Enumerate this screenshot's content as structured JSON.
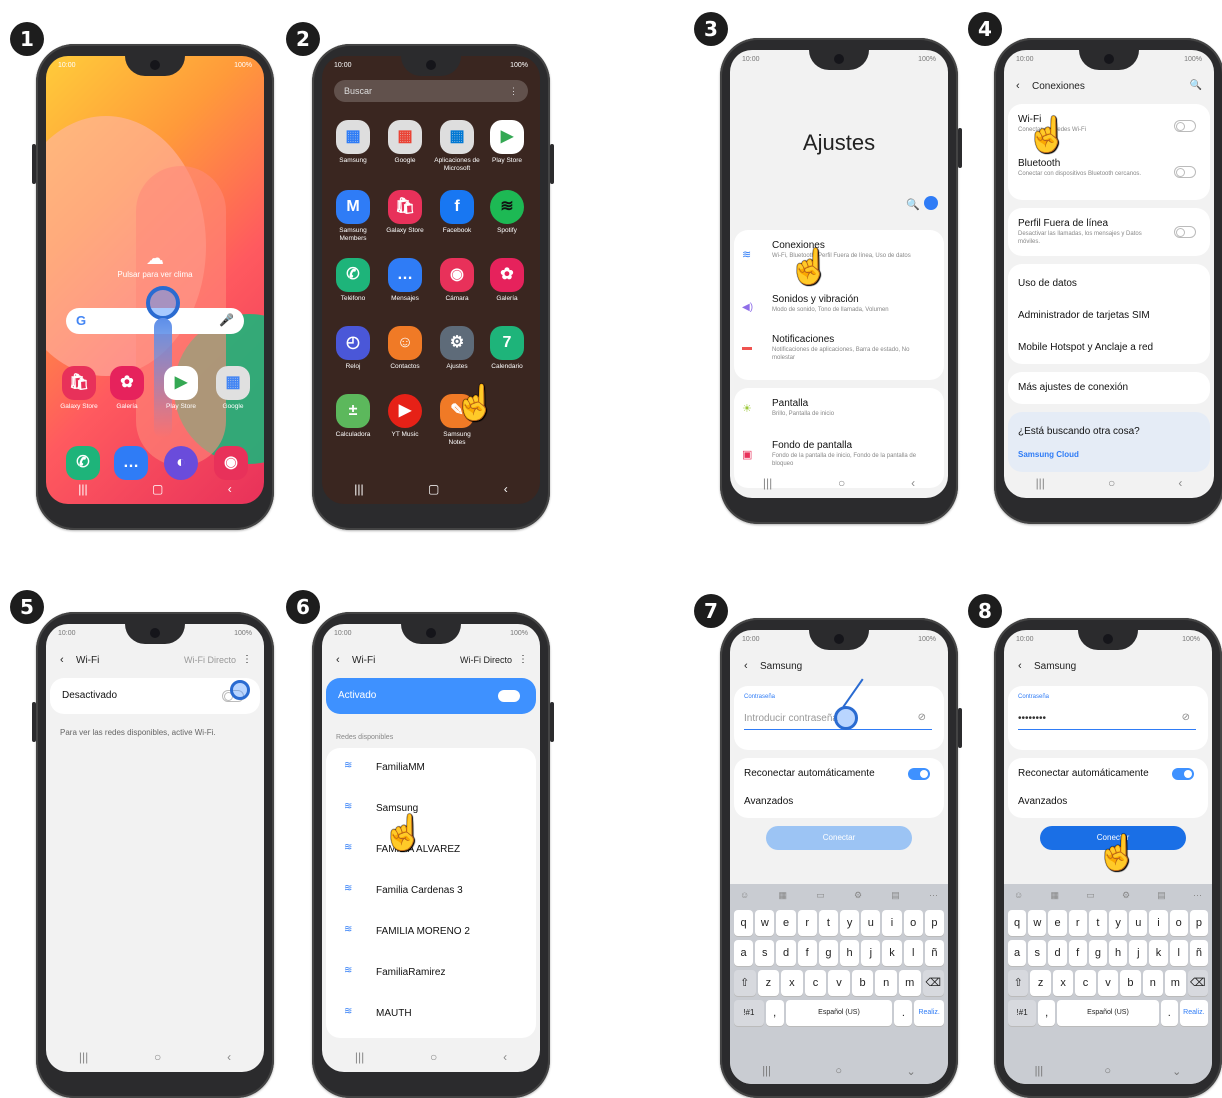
{
  "steps": [
    "1",
    "2",
    "3",
    "4",
    "5",
    "6",
    "7",
    "8"
  ],
  "status": {
    "time": "10:00",
    "battery": "100%"
  },
  "s1": {
    "weather": "Pulsar para ver clima",
    "apps": [
      "Galaxy Store",
      "Galería",
      "Play Store",
      "Google"
    ]
  },
  "s2": {
    "search": "Buscar",
    "apps": [
      "Samsung",
      "Google",
      "Aplicaciones de Microsoft",
      "Play Store",
      "Samsung Members",
      "Galaxy Store",
      "Facebook",
      "Spotify",
      "Teléfono",
      "Mensajes",
      "Cámara",
      "Galería",
      "Reloj",
      "Contactos",
      "Ajustes",
      "Calendario",
      "Calculadora",
      "YT Music",
      "Samsung Notes"
    ]
  },
  "s3": {
    "title": "Ajustes",
    "items": [
      {
        "t": "Conexiones",
        "s": "Wi-Fi, Bluetooth, Perfil Fuera de línea, Uso de datos"
      },
      {
        "t": "Sonidos y vibración",
        "s": "Modo de sonido, Tono de llamada, Volumen"
      },
      {
        "t": "Notificaciones",
        "s": "Notificaciones de aplicaciones, Barra de estado, No molestar"
      },
      {
        "t": "Pantalla",
        "s": "Brillo, Pantalla de inicio"
      },
      {
        "t": "Fondo de pantalla",
        "s": "Fondo de la pantalla de inicio, Fondo de la pantalla de bloqueo"
      }
    ]
  },
  "s4": {
    "header": "Conexiones",
    "wifi": "Wi-Fi",
    "wifi_sub": "Conectar con redes Wi-Fi",
    "bt": "Bluetooth",
    "bt_sub": "Conectar con dispositivos Bluetooth cercanos.",
    "offline": "Perfil Fuera de línea",
    "offline_sub": "Desactivar las llamadas, los mensajes y Datos móviles.",
    "data": "Uso de datos",
    "sim": "Administrador de tarjetas SIM",
    "hotspot": "Mobile Hotspot y Anclaje a red",
    "more": "Más ajustes de conexión",
    "looking": "¿Está buscando otra cosa?",
    "cloud": "Samsung Cloud"
  },
  "s5": {
    "header": "Wi-Fi",
    "direct": "Wi-Fi Directo",
    "state": "Desactivado",
    "info": "Para ver las redes disponibles, active Wi-Fi."
  },
  "s6": {
    "header": "Wi-Fi",
    "direct": "Wi-Fi Directo",
    "state": "Activado",
    "section": "Redes disponibles",
    "networks": [
      "FamiliaMM",
      "Samsung",
      "FAMILIA ALVAREZ",
      "Familia Cardenas 3",
      "FAMILIA MORENO 2",
      "FamiliaRamirez",
      "MAUTH"
    ]
  },
  "s7": {
    "header": "Samsung",
    "label": "Contraseña",
    "placeholder": "Introducir contraseña",
    "reconnect": "Reconectar automáticamente",
    "advanced": "Avanzados",
    "connect": "Conectar"
  },
  "s8": {
    "header": "Samsung",
    "label": "Contraseña",
    "password": "••••••••",
    "reconnect": "Reconectar automáticamente",
    "advanced": "Avanzados",
    "connect": "Conectar"
  },
  "keyboard": {
    "row1": [
      "q",
      "w",
      "e",
      "r",
      "t",
      "y",
      "u",
      "i",
      "o",
      "p"
    ],
    "row2": [
      "a",
      "s",
      "d",
      "f",
      "g",
      "h",
      "j",
      "k",
      "l",
      "ñ"
    ],
    "row3": [
      "z",
      "x",
      "c",
      "v",
      "b",
      "n",
      "m"
    ],
    "sym": "!#1",
    "lang": "Español (US)",
    "done": "Realiz."
  }
}
